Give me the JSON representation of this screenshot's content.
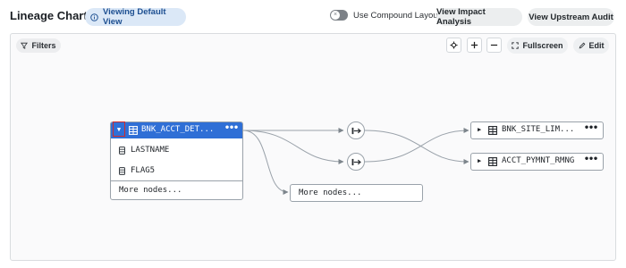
{
  "header": {
    "title": "Lineage Chart",
    "viewing_label": "Viewing Default View",
    "compound_layout_label": "Use Compound Layout",
    "compound_layout_on": false,
    "impact_label": "View Impact Analysis",
    "upstream_label": "View Upstream Audit"
  },
  "toolbar": {
    "filters_label": "Filters",
    "fullscreen_label": "Fullscreen",
    "edit_label": "Edit"
  },
  "graph": {
    "source_node": {
      "label": "BNK_ACCT_DET...",
      "columns": [
        "LASTNAME",
        "FLAG5"
      ],
      "more_label": "More nodes...",
      "expanded": true
    },
    "more_node_label": "More nodes...",
    "targets": [
      {
        "label": "BNK_SITE_LIM...",
        "menu": "•••"
      },
      {
        "label": "ACCT_PYMNT_RMNG",
        "menu": "•••"
      }
    ],
    "source_menu": "•••"
  },
  "colors": {
    "accent": "#2f6fd6",
    "highlight_border": "#d12b2b",
    "pill_bg": "#dbe8f7",
    "pill_text": "#1d4f91"
  },
  "icons": [
    "info-icon",
    "toggle-x-icon",
    "filter-icon",
    "recenter-icon",
    "zoom-in-icon",
    "zoom-out-icon",
    "fullscreen-icon",
    "edit-icon",
    "table-icon",
    "column-icon",
    "process-icon",
    "caret-right-icon",
    "caret-down-icon"
  ]
}
